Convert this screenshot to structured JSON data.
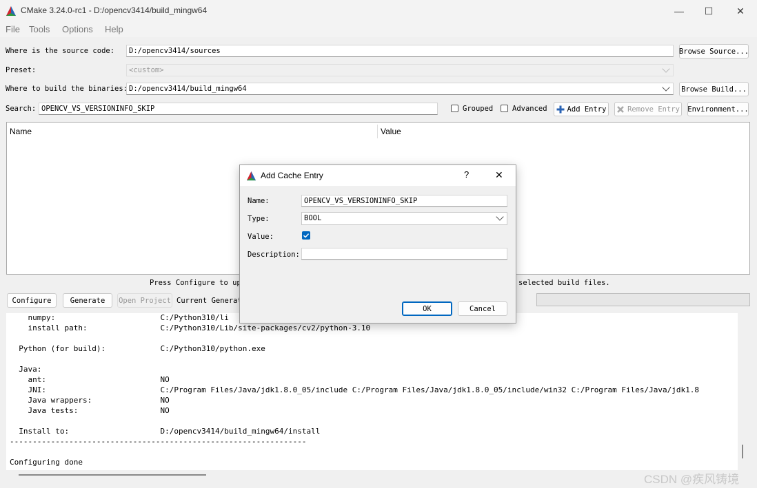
{
  "window": {
    "title": "CMake 3.24.0-rc1 - D:/opencv3414/build_mingw64",
    "minimize_glyph": "—",
    "maximize_glyph": "☐",
    "close_glyph": "✕"
  },
  "menu": [
    "File",
    "Tools",
    "Options",
    "Help"
  ],
  "source": {
    "label": "Where is the source code:",
    "value": "D:/opencv3414/sources",
    "browse": "Browse Source..."
  },
  "preset": {
    "label": "Preset:",
    "value": "<custom>"
  },
  "build": {
    "label": "Where to build the binaries:",
    "value": "D:/opencv3414/build_mingw64",
    "browse": "Browse Build..."
  },
  "search": {
    "label": "Search:",
    "value": "OPENCV_VS_VERSIONINFO_SKIP"
  },
  "options": {
    "grouped": "Grouped",
    "advanced": "Advanced",
    "add_entry": "Add Entry",
    "remove_entry": "Remove Entry",
    "environment": "Environment..."
  },
  "table": {
    "col_name": "Name",
    "col_value": "Value"
  },
  "status": {
    "left": "Press Configure to upd",
    "right": "selected build files."
  },
  "actions": {
    "configure": "Configure",
    "generate": "Generate",
    "open_project": "Open Project",
    "current_generator": "Current Generat"
  },
  "output_lines": [
    "    numpy:                       C:/Python310/li",
    "    install path:                C:/Python310/Lib/site-packages/cv2/python-3.10",
    "",
    "  Python (for build):            C:/Python310/python.exe",
    "",
    "  Java:",
    "    ant:                         NO",
    "    JNI:                         C:/Program Files/Java/jdk1.8.0_05/include C:/Program Files/Java/jdk1.8.0_05/include/win32 C:/Program Files/Java/jdk1.8",
    "    Java wrappers:               NO",
    "    Java tests:                  NO",
    "",
    "  Install to:                    D:/opencv3414/build_mingw64/install",
    "-----------------------------------------------------------------",
    "",
    "Configuring done"
  ],
  "dialog": {
    "title": "Add Cache Entry",
    "help_glyph": "?",
    "close_glyph": "✕",
    "name_label": "Name:",
    "name_value": "OPENCV_VS_VERSIONINFO_SKIP",
    "type_label": "Type:",
    "type_value": "BOOL",
    "value_label": "Value:",
    "value_checked": true,
    "description_label": "Description:",
    "description_value": "",
    "ok": "OK",
    "cancel": "Cancel"
  },
  "watermark": "CSDN @疾风铸境",
  "colors": {
    "accent": "#0067c0",
    "cmake_red": "#d8232a",
    "cmake_green": "#2c9a3f",
    "cmake_blue": "#2a63b4"
  }
}
